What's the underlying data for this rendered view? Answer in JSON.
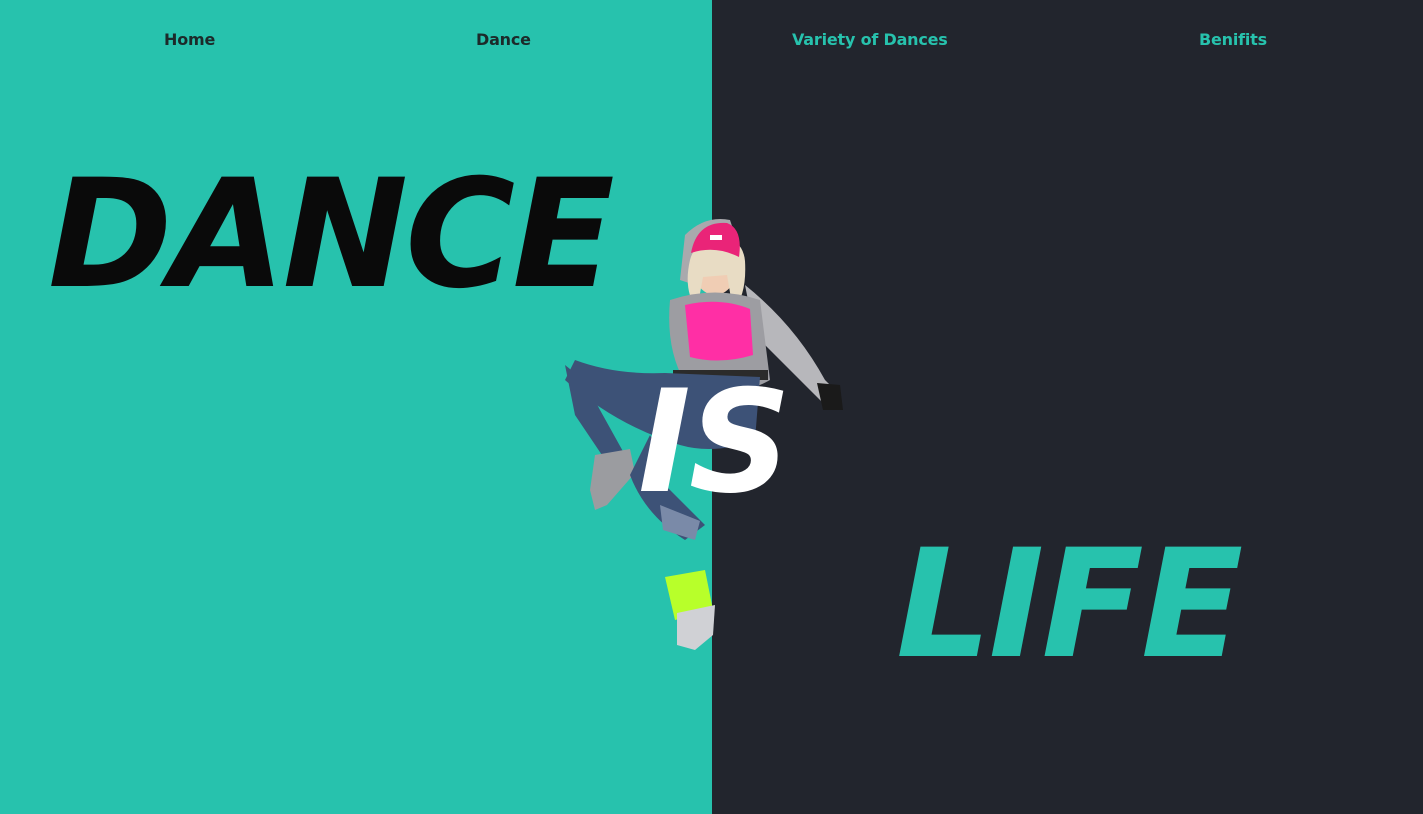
{
  "colors": {
    "teal": "#27c2ad",
    "dark": "#22252d",
    "black": "#0a0a0a",
    "white": "#ffffff"
  },
  "nav": {
    "home": "Home",
    "dance": "Dance",
    "variety": "Variety of Dances",
    "benefits": "Benifits"
  },
  "hero": {
    "word1": "DANCE",
    "word2": "IS",
    "word3": "LIFE"
  },
  "image": {
    "icon": "dancer-photo"
  }
}
